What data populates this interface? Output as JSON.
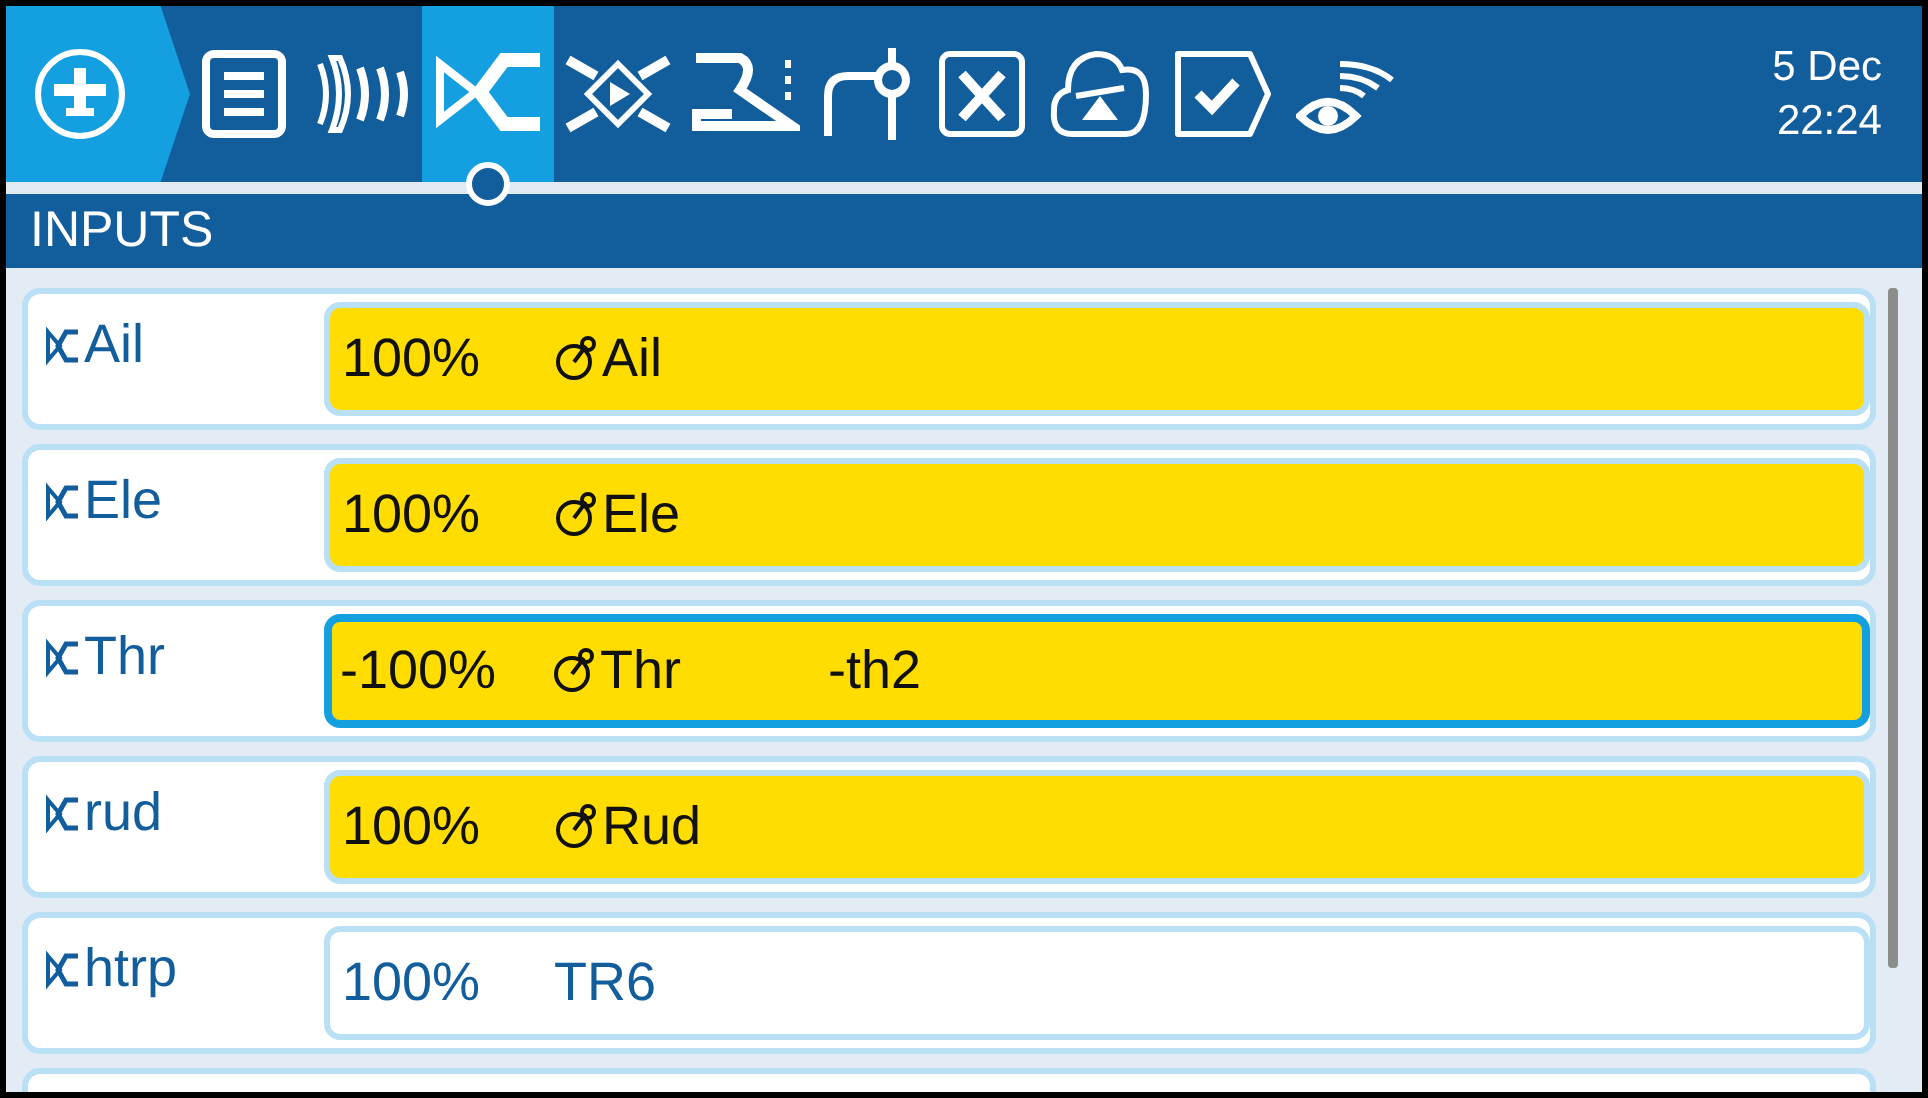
{
  "header": {
    "model_button": {
      "kind": "model"
    },
    "tabs": [
      {
        "kind": "list",
        "selected": false
      },
      {
        "kind": "waves",
        "selected": false
      },
      {
        "kind": "inputs",
        "selected": true
      },
      {
        "kind": "mixer",
        "selected": false
      },
      {
        "kind": "outputs",
        "selected": false
      },
      {
        "kind": "curve",
        "selected": false
      },
      {
        "kind": "variable",
        "selected": false
      },
      {
        "kind": "cloud",
        "selected": false
      },
      {
        "kind": "checklist",
        "selected": false
      },
      {
        "kind": "telemetry",
        "selected": false
      }
    ],
    "date": "5 Dec",
    "time": "22:24"
  },
  "section_title": "INPUTS",
  "inputs": [
    {
      "name": "Ail",
      "weight": "100%",
      "kind": "stick",
      "source": "Ail",
      "active": true,
      "focused": false
    },
    {
      "name": "Ele",
      "weight": "100%",
      "kind": "stick",
      "source": "Ele",
      "active": true,
      "focused": false
    },
    {
      "name": "Thr",
      "weight": "-100%",
      "kind": "stick",
      "source": "Thr",
      "extra": "-th2",
      "active": true,
      "focused": true
    },
    {
      "name": "rud",
      "weight": "100%",
      "kind": "stick",
      "source": "Rud",
      "active": true,
      "focused": false
    },
    {
      "name": "htrp",
      "weight": "100%",
      "kind": "trim",
      "source": "TR6",
      "active": false,
      "focused": false
    }
  ]
}
